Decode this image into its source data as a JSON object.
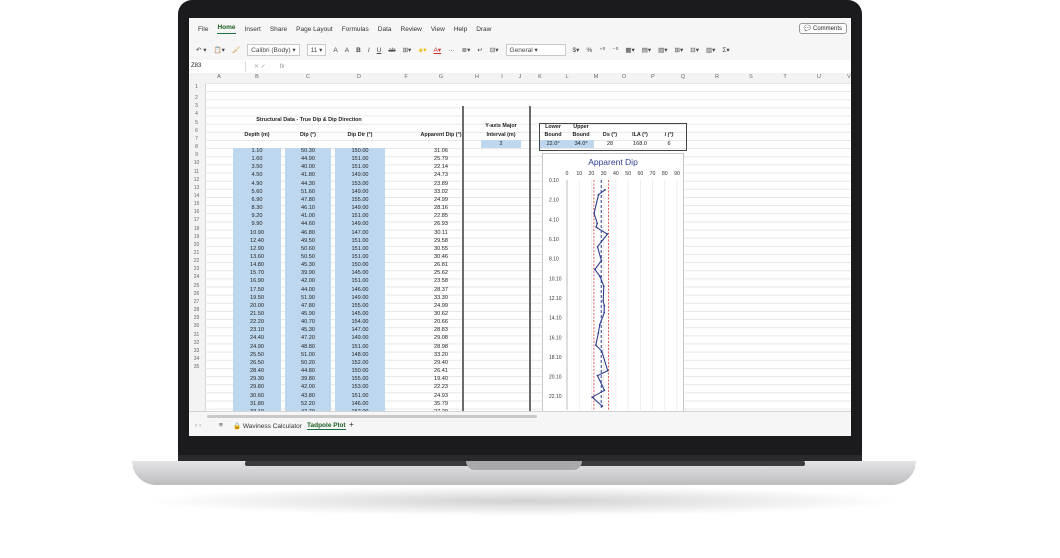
{
  "menu": [
    "File",
    "Home",
    "Insert",
    "Share",
    "Page Layout",
    "Formulas",
    "Data",
    "Review",
    "View",
    "Help",
    "Draw"
  ],
  "menu_active": "Home",
  "comments_label": "Comments",
  "toolbar": {
    "font_name": "Calibri (Body)",
    "font_size": "11",
    "number_format": "General",
    "grow_font": "A",
    "shrink_font": "A",
    "bold": "B",
    "italic": "I",
    "underline": "U",
    "strike": "ab",
    "more": "···",
    "currency": "$",
    "percent": "%",
    "sum": "Σ"
  },
  "namebox": "Z83",
  "fx": "fx",
  "columns": [
    "A",
    "B",
    "C",
    "D",
    "F",
    "G",
    "H",
    "I",
    "J",
    "K",
    "L",
    "M",
    "O",
    "P",
    "Q",
    "R",
    "S",
    "T",
    "U",
    "V",
    "W"
  ],
  "rows": [
    "1",
    "2",
    "3",
    "4",
    "5",
    "6",
    "7",
    "8",
    "9",
    "10",
    "11",
    "12",
    "13",
    "14",
    "15",
    "16",
    "17",
    "18",
    "19",
    "20",
    "21",
    "22",
    "23",
    "24",
    "25",
    "26",
    "27",
    "28",
    "29",
    "30",
    "31",
    "32",
    "33",
    "34",
    "35"
  ],
  "sheet_title": "Structural Data - True Dip & Dip Direction",
  "headers": {
    "depth": "Depth (m)",
    "dip": "Dip (°)",
    "dipdir": "Dip Dir (°)",
    "apparent": "Apparent Dip (°)",
    "yaxis1": "Y-axis Major",
    "yaxis2": "Interval (m)",
    "lower1": "Lower",
    "lower2": "Bound",
    "upper1": "Upper",
    "upper2": "Bound",
    "ds": "Ds (°)",
    "ila": "ILA (°)",
    "i": "i (°)"
  },
  "yaxis_interval": "2",
  "bounds": {
    "lower": "22.0°",
    "upper": "34.0°",
    "ds": "28",
    "ila": "168.0",
    "i": "6"
  },
  "table": [
    [
      "1.10",
      "50.30",
      "150.00",
      "31.06"
    ],
    [
      "1.60",
      "44.90",
      "151.00",
      "25.79"
    ],
    [
      "3.50",
      "40.00",
      "151.00",
      "22.14"
    ],
    [
      "4.50",
      "41.80",
      "149.00",
      "24.73"
    ],
    [
      "4.90",
      "44.30",
      "153.00",
      "23.89"
    ],
    [
      "5.60",
      "51.60",
      "149.00",
      "33.02"
    ],
    [
      "6.90",
      "47.80",
      "155.00",
      "24.99"
    ],
    [
      "8.30",
      "46.10",
      "149.00",
      "28.16"
    ],
    [
      "9.20",
      "41.00",
      "151.00",
      "22.85"
    ],
    [
      "9.90",
      "44.60",
      "149.00",
      "26.93"
    ],
    [
      "10.90",
      "46.80",
      "147.00",
      "30.11"
    ],
    [
      "12.40",
      "49.50",
      "151.00",
      "29.58"
    ],
    [
      "12.90",
      "50.60",
      "151.00",
      "30.55"
    ],
    [
      "13.60",
      "50.50",
      "151.00",
      "30.46"
    ],
    [
      "14.80",
      "45.30",
      "150.00",
      "26.81"
    ],
    [
      "15.70",
      "39.90",
      "145.00",
      "25.62"
    ],
    [
      "16.90",
      "42.00",
      "151.00",
      "23.58"
    ],
    [
      "17.50",
      "44.00",
      "146.00",
      "28.37"
    ],
    [
      "19.50",
      "51.90",
      "149.00",
      "33.30"
    ],
    [
      "20.00",
      "47.80",
      "155.00",
      "24.99"
    ],
    [
      "21.50",
      "45.90",
      "145.00",
      "30.62"
    ],
    [
      "22.20",
      "40.70",
      "154.00",
      "20.66"
    ],
    [
      "23.10",
      "45.30",
      "147.00",
      "28.83"
    ],
    [
      "24.40",
      "47.20",
      "149.00",
      "29.08"
    ],
    [
      "24.90",
      "48.80",
      "151.00",
      "28.98"
    ],
    [
      "25.50",
      "51.00",
      "148.00",
      "33.20"
    ],
    [
      "26.50",
      "50.20",
      "152.00",
      "29.40"
    ],
    [
      "28.40",
      "44.80",
      "150.00",
      "26.41"
    ],
    [
      "29.30",
      "39.80",
      "155.00",
      "19.40"
    ],
    [
      "29.80",
      "42.00",
      "153.00",
      "22.23"
    ],
    [
      "30.60",
      "43.80",
      "151.00",
      "24.93"
    ],
    [
      "31.80",
      "52.20",
      "146.00",
      "35.79"
    ],
    [
      "33.10",
      "47.70",
      "152.00",
      "27.29"
    ]
  ],
  "chart_data": {
    "type": "line",
    "title": "Apparent Dip",
    "x_ticks": [
      "0",
      "10",
      "20",
      "30",
      "40",
      "50",
      "60",
      "70",
      "80",
      "90"
    ],
    "y_ticks": [
      "0.10",
      "2.10",
      "4.10",
      "6.10",
      "8.10",
      "10.10",
      "12.10",
      "14.10",
      "16.10",
      "18.10",
      "20.10",
      "22.10"
    ],
    "xlim": [
      0,
      90
    ],
    "ylim": [
      0.1,
      23.5
    ],
    "y_reversed": true,
    "series": [
      {
        "x": [
          31.06,
          25.79,
          22.14,
          24.73,
          23.89,
          33.02,
          24.99,
          28.16,
          22.85,
          26.93,
          30.11,
          29.58,
          30.55,
          30.46,
          26.81,
          25.62,
          23.58,
          28.37,
          33.3,
          24.99,
          30.62,
          20.66,
          28.83,
          29.08,
          28.98,
          33.2,
          29.4,
          26.41,
          19.4,
          22.23,
          24.93,
          35.79,
          27.29
        ],
        "y": [
          1.1,
          1.6,
          3.5,
          4.5,
          4.9,
          5.6,
          6.9,
          8.3,
          9.2,
          9.9,
          10.9,
          12.4,
          12.9,
          13.6,
          14.8,
          15.7,
          16.9,
          17.5,
          19.5,
          20.0,
          21.5,
          22.2,
          23.1,
          24.4,
          24.9,
          25.5,
          26.5,
          28.4,
          29.3,
          29.8,
          30.6,
          31.8,
          33.1
        ],
        "color": "#2e3f8f"
      }
    ],
    "reference_lines": {
      "lower_bound": 22.0,
      "upper_bound": 34.0,
      "ds": 28
    },
    "bound_color": "#e53935",
    "ds_color": "#2e3f8f"
  },
  "sheet_tabs": [
    "Waviness Calculator",
    "Tadpole Plot"
  ],
  "active_sheet": "Tadpole Plot",
  "add_sheet": "+"
}
